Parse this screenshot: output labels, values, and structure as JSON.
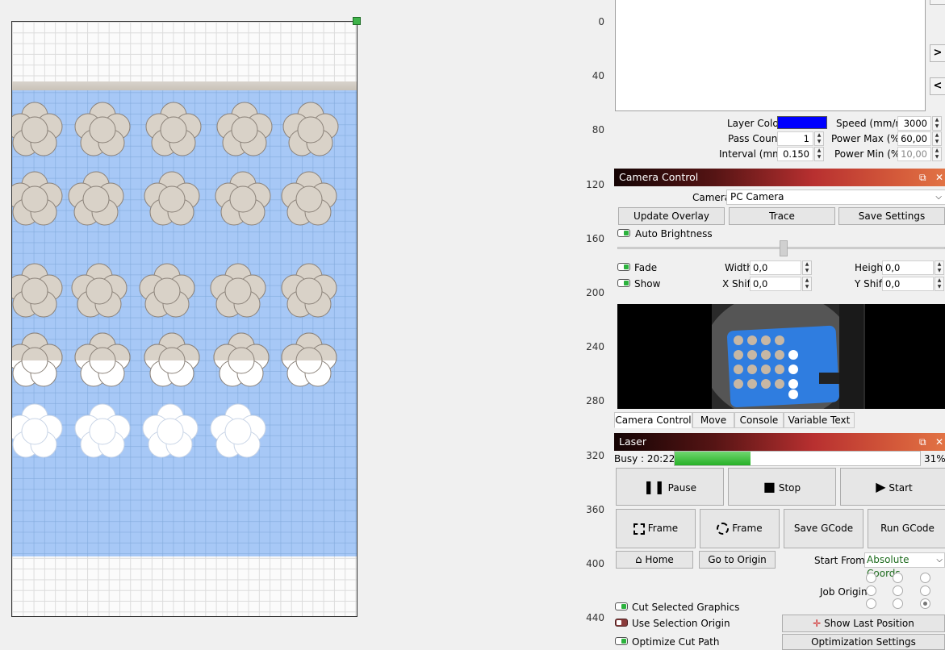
{
  "ruler": {
    "ticks": [
      "0",
      "40",
      "80",
      "120",
      "160",
      "200",
      "240",
      "280",
      "320",
      "360",
      "400",
      "440"
    ]
  },
  "cuts_layers": {
    "layer_color_label": "Layer Color",
    "layer_color": "#0000ff",
    "speed_label": "Speed (mm/m)",
    "speed": "3000",
    "pass_count_label": "Pass Count",
    "pass_count": "1",
    "power_max_label": "Power Max (%)",
    "power_max": "60,00",
    "interval_label": "Interval (mm)",
    "interval": "0.150",
    "power_min_label": "Power Min (%)",
    "power_min": "10,00",
    "side_buttons": [
      ">",
      "<"
    ]
  },
  "camera": {
    "title": "Camera Control",
    "camera_label": "Camera:",
    "camera_value": "PC Camera",
    "update_overlay": "Update Overlay",
    "trace": "Trace",
    "save_settings": "Save Settings",
    "auto_brightness": "Auto Brightness",
    "fade": "Fade",
    "show": "Show",
    "width_label": "Width",
    "width_value": "0,0",
    "height_label": "Height",
    "height_value": "0,0",
    "xshift_label": "X Shift",
    "xshift_value": "0,0",
    "yshift_label": "Y Shift",
    "yshift_value": "0,0"
  },
  "tabs": [
    "Camera Control",
    "Move",
    "Console",
    "Variable Text"
  ],
  "laser": {
    "title": "Laser",
    "status": "Busy : 20:22",
    "progress": 31,
    "progress_label": "31%",
    "pause": "Pause",
    "stop": "Stop",
    "start": "Start",
    "frame1": "Frame",
    "frame2": "Frame",
    "save_gcode": "Save GCode",
    "run_gcode": "Run GCode",
    "home": "Home",
    "go_to_origin": "Go to Origin",
    "start_from_label": "Start From:",
    "start_from_value": "Absolute Coords",
    "job_origin_label": "Job Origin",
    "cut_selected": "Cut Selected Graphics",
    "use_selection_origin": "Use Selection Origin",
    "optimize_cut_path": "Optimize Cut Path",
    "show_last_position": "Show Last Position",
    "optimization_settings": "Optimization Settings"
  },
  "colors": {
    "accent_green": "#2cb23d",
    "overlay_blue": "#a7c8f6"
  }
}
